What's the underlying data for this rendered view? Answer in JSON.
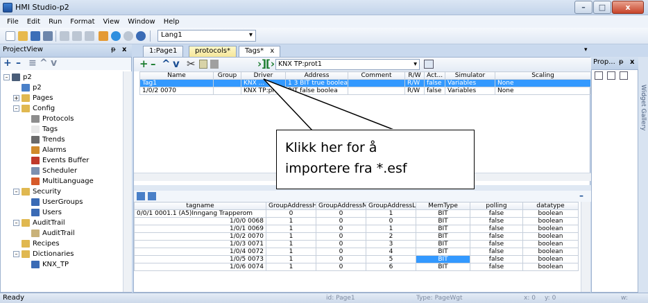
{
  "window": {
    "title": "HMI Studio-p2",
    "min": "–",
    "max": "□",
    "close": "x"
  },
  "menu": [
    "File",
    "Edit",
    "Run",
    "Format",
    "View",
    "Window",
    "Help"
  ],
  "toolbar": {
    "language": "Lang1"
  },
  "project_view": {
    "title": "ProjectView",
    "pin": "ᵽ",
    "close": "x",
    "toolbar_symbols": [
      "+",
      "–",
      "≡",
      "^",
      "v"
    ]
  },
  "tree": [
    {
      "label": "p2",
      "level": 0,
      "exp": "–",
      "icon": "root-icon",
      "color": "#4a5d78"
    },
    {
      "label": "p2",
      "level": 1,
      "exp": "",
      "icon": "project-icon",
      "color": "#4a80c8"
    },
    {
      "label": "Pages",
      "level": 1,
      "exp": "+",
      "icon": "folder-icon",
      "color": "#e0b850"
    },
    {
      "label": "Config",
      "level": 1,
      "exp": "–",
      "icon": "folder-icon",
      "color": "#e0b850"
    },
    {
      "label": "Protocols",
      "level": 2,
      "exp": "",
      "icon": "protocols-icon",
      "color": "#8d8d8d"
    },
    {
      "label": "Tags",
      "level": 2,
      "exp": "",
      "icon": "tags-icon",
      "color": "#e8e8e8"
    },
    {
      "label": "Trends",
      "level": 2,
      "exp": "",
      "icon": "trends-icon",
      "color": "#6a6a6a"
    },
    {
      "label": "Alarms",
      "level": 2,
      "exp": "",
      "icon": "alarms-icon",
      "color": "#d08a2b"
    },
    {
      "label": "Events Buffer",
      "level": 2,
      "exp": "",
      "icon": "events-icon",
      "color": "#c0392b"
    },
    {
      "label": "Scheduler",
      "level": 2,
      "exp": "",
      "icon": "scheduler-icon",
      "color": "#7c90b0"
    },
    {
      "label": "MultiLanguage",
      "level": 2,
      "exp": "",
      "icon": "language-icon",
      "color": "#d65a2a"
    },
    {
      "label": "Security",
      "level": 1,
      "exp": "–",
      "icon": "folder-icon",
      "color": "#e0b850"
    },
    {
      "label": "UserGroups",
      "level": 2,
      "exp": "",
      "icon": "usergroups-icon",
      "color": "#3a6bb5"
    },
    {
      "label": "Users",
      "level": 2,
      "exp": "",
      "icon": "users-icon",
      "color": "#3a6bb5"
    },
    {
      "label": "AuditTrail",
      "level": 1,
      "exp": "–",
      "icon": "folder-icon",
      "color": "#e0b850"
    },
    {
      "label": "AuditTrail",
      "level": 2,
      "exp": "",
      "icon": "audittrail-icon",
      "color": "#c9b27a"
    },
    {
      "label": "Recipes",
      "level": 1,
      "exp": "",
      "icon": "folder-icon",
      "color": "#e0b850"
    },
    {
      "label": "Dictionaries",
      "level": 1,
      "exp": "–",
      "icon": "folder-icon",
      "color": "#e0b850"
    },
    {
      "label": "KNX_TP",
      "level": 2,
      "exp": "",
      "icon": "dictionary-icon",
      "color": "#3a6bb5"
    }
  ],
  "tabs": [
    {
      "label": "1:Page1"
    },
    {
      "label": "protocols*"
    },
    {
      "label": "Tags*",
      "close": "x"
    }
  ],
  "editor": {
    "protocol_filter": "KNX TP:prot1"
  },
  "tags": {
    "headers": [
      "Name",
      "Group",
      "Driver",
      "Address",
      "Comment",
      "R/W",
      "Act...",
      "Simulator",
      "Scaling"
    ],
    "rows": [
      [
        "Tag1",
        "",
        "KNX ...",
        "1 3 BIT true boolea",
        "",
        "R/W",
        "false",
        "Variables",
        "None"
      ],
      [
        "1/0/2 0070",
        "",
        "KNX TP:prot1",
        "BIT false boolea",
        "",
        "R/W",
        "false",
        "Variables",
        "None"
      ]
    ]
  },
  "import": {
    "headers": [
      "tagname",
      "GroupAddressH",
      "GroupAddressM",
      "GroupAddressL",
      "MemType",
      "polling",
      "datatype"
    ],
    "rows": [
      [
        "0/0/1 0001.1 (A5)Inngang Trapperom",
        "0",
        "0",
        "1",
        "BIT",
        "false",
        "boolean"
      ],
      [
        "1/0/0 0068",
        "1",
        "0",
        "0",
        "BIT",
        "false",
        "boolean"
      ],
      [
        "1/0/1 0069",
        "1",
        "0",
        "1",
        "BIT",
        "false",
        "boolean"
      ],
      [
        "1/0/2 0070",
        "1",
        "0",
        "2",
        "BIT",
        "false",
        "boolean"
      ],
      [
        "1/0/3 0071",
        "1",
        "0",
        "3",
        "BIT",
        "false",
        "boolean"
      ],
      [
        "1/0/4 0072",
        "1",
        "0",
        "4",
        "BIT",
        "false",
        "boolean"
      ],
      [
        "1/0/5 0073",
        "1",
        "0",
        "5",
        "BIT",
        "false",
        "boolean"
      ],
      [
        "1/0/6 0074",
        "1",
        "0",
        "6",
        "BIT",
        "false",
        "boolean"
      ]
    ]
  },
  "properties": {
    "title": "Prop...",
    "pin": "ᵽ",
    "close": "x"
  },
  "widget_gallery": "Widget Gallery",
  "status": {
    "ready": "Ready",
    "id": "id: Page1",
    "type": "Type: PageWgt",
    "x": "x: 0",
    "y": "y: 0",
    "w": "w:"
  },
  "callout": {
    "line1": "Klikk her for å",
    "line2": "importere fra *.esf"
  }
}
